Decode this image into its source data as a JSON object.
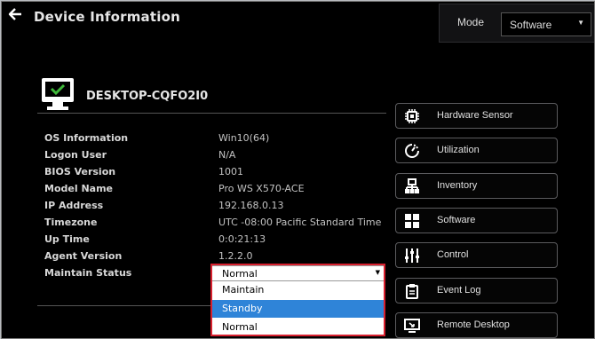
{
  "header": {
    "title": "Device Information",
    "back_icon": "back-arrow-icon"
  },
  "mode": {
    "label": "Mode",
    "selected": "Software"
  },
  "device": {
    "name": "DESKTOP-CQFO2I0",
    "icon": "monitor-check-icon",
    "status_color": "#3fb83a"
  },
  "info": [
    {
      "label": "OS Information",
      "value": "Win10(64)"
    },
    {
      "label": "Logon User",
      "value": "N/A"
    },
    {
      "label": "BIOS Version",
      "value": "1001"
    },
    {
      "label": "Model Name",
      "value": "Pro WS X570-ACE"
    },
    {
      "label": "IP Address",
      "value": "192.168.0.13"
    },
    {
      "label": "Timezone",
      "value": "UTC -08:00 Pacific Standard Time"
    },
    {
      "label": "Up Time",
      "value": "0:0:21:13"
    },
    {
      "label": "Agent Version",
      "value": "1.2.2.0"
    }
  ],
  "maintain_status": {
    "label": "Maintain Status",
    "selected": "Normal",
    "options": [
      "Maintain",
      "Standby",
      "Normal"
    ],
    "highlighted": "Standby",
    "accent": "#2f84d8",
    "highlight_border": "#d9202f"
  },
  "side_buttons": [
    {
      "label": "Hardware Sensor",
      "icon": "chip-icon"
    },
    {
      "label": "Utilization",
      "icon": "gauge-icon"
    },
    {
      "label": "Inventory",
      "icon": "inventory-icon"
    },
    {
      "label": "Software",
      "icon": "grid-icon"
    },
    {
      "label": "Control",
      "icon": "sliders-icon"
    },
    {
      "label": "Event Log",
      "icon": "clipboard-icon"
    },
    {
      "label": "Remote Desktop",
      "icon": "remote-desktop-icon"
    }
  ]
}
